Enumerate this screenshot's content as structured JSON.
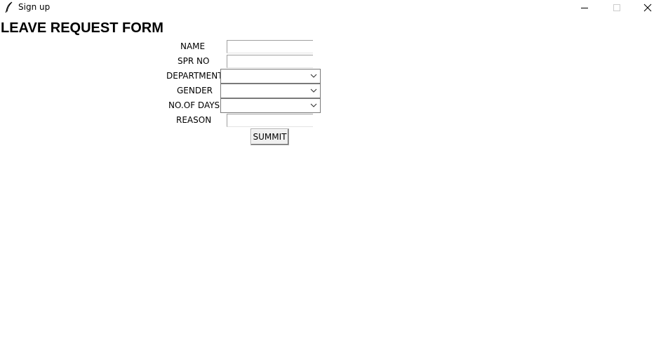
{
  "window": {
    "title": "Sign up",
    "minimize_icon": "minimize-icon",
    "maximize_icon": "maximize-icon",
    "close_icon": "close-icon"
  },
  "form": {
    "title": "LEAVE REQUEST FORM",
    "fields": {
      "name": {
        "label": "NAME",
        "value": ""
      },
      "spr_no": {
        "label": "SPR NO",
        "value": ""
      },
      "department": {
        "label": "DEPARTMENT",
        "value": ""
      },
      "gender": {
        "label": "GENDER",
        "value": ""
      },
      "days": {
        "label": "NO.OF DAYS",
        "value": ""
      },
      "reason": {
        "label": "REASON",
        "value": ""
      }
    },
    "submit_label": "SUMMIT"
  }
}
